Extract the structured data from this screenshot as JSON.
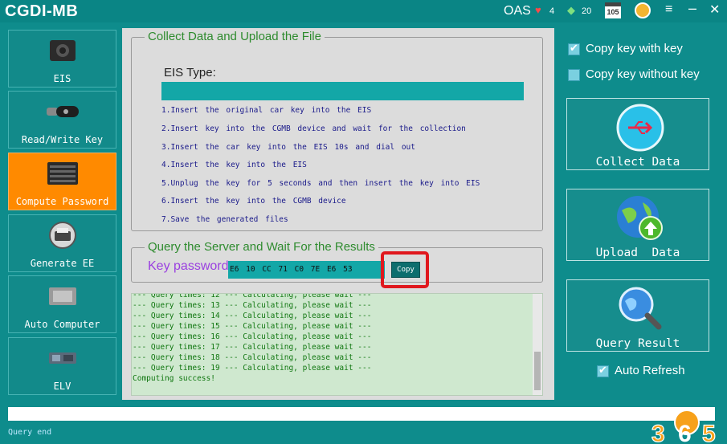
{
  "window": {
    "title": "CGDI-MB",
    "oas_label": "OAS",
    "hearts": "4",
    "gems": "20",
    "calendar_day": "105"
  },
  "sidebar": {
    "items": [
      {
        "label": "EIS"
      },
      {
        "label": "Read/Write Key"
      },
      {
        "label": "Compute Password",
        "active": true
      },
      {
        "label": "Generate EE"
      },
      {
        "label": "Auto Computer"
      },
      {
        "label": "ELV"
      }
    ]
  },
  "collect": {
    "legend": "Collect Data and Upload the File",
    "eis_type_label": "EIS Type:",
    "eis_type_value": "",
    "steps": [
      "1.Insert the original car key into the EIS",
      "2.Insert key into the CGMB device and wait for the collection",
      "3.Insert the car key into the EIS 10s and dial out",
      "4.Insert the key into the EIS",
      "5.Unplug the key for 5 seconds and then insert the key into EIS",
      "6.Insert the key into the CGMB device",
      "7.Save the generated files"
    ]
  },
  "query": {
    "legend": "Query the Server and Wait For the Results",
    "key_password_label": "Key password",
    "key_password_value": "E6 10 CC 71 C0 7E E6 53",
    "copy_label": "Copy"
  },
  "log": {
    "lines": [
      "--- Query times: 12 --- Calculating, please wait ---",
      "--- Query times: 13 --- Calculating, please wait ---",
      "--- Query times: 14 --- Calculating, please wait ---",
      "--- Query times: 15 --- Calculating, please wait ---",
      "--- Query times: 16 --- Calculating, please wait ---",
      "--- Query times: 17 --- Calculating, please wait ---",
      "--- Query times: 18 --- Calculating, please wait ---",
      "--- Query times: 19 --- Calculating, please wait ---",
      "Computing success!"
    ]
  },
  "options": {
    "copy_with_key": {
      "label": "Copy key with key",
      "checked": true
    },
    "copy_without_key": {
      "label": "Copy key without key",
      "checked": false
    },
    "auto_refresh": {
      "label": "Auto Refresh",
      "checked": true
    }
  },
  "actions": {
    "collect_data": "Collect Data",
    "upload_data": "Upload  Data",
    "query_result": "Query Result"
  },
  "status": {
    "text": "Query end"
  },
  "watermark": {
    "text": "365"
  },
  "colors": {
    "background": "#0e8c8c",
    "active_tab": "#ff8a00",
    "legend_text": "#2e8b2e",
    "key_label": "#9a3fe0",
    "highlight_frame": "#e0181e"
  }
}
